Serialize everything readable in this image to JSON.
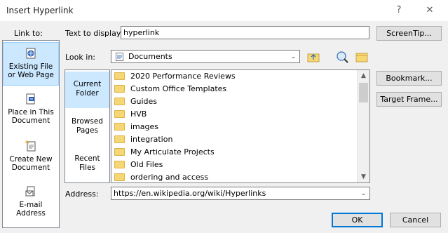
{
  "window": {
    "title": "Insert Hyperlink",
    "help": "?",
    "close": "✕"
  },
  "link_to": {
    "label": "Link to:",
    "items": [
      {
        "line1": "Existing File",
        "line2": "or Web Page",
        "icon": "web-page-icon",
        "selected": true
      },
      {
        "line1": "Place in This",
        "line2": "Document",
        "icon": "document-place-icon",
        "selected": false
      },
      {
        "line1": "Create New",
        "line2": "Document",
        "icon": "new-document-icon",
        "selected": false
      },
      {
        "line1": "E-mail",
        "line2": "Address",
        "icon": "email-icon",
        "selected": false
      }
    ]
  },
  "text_to_display": {
    "label": "Text to display:",
    "value": "hyperlink"
  },
  "screentip_button": "ScreenTip...",
  "look_in": {
    "label": "Look in:",
    "value": "Documents"
  },
  "nav": [
    {
      "line1": "Current",
      "line2": "Folder",
      "selected": true
    },
    {
      "line1": "Browsed",
      "line2": "Pages",
      "selected": false
    },
    {
      "line1": "Recent",
      "line2": "Files",
      "selected": false
    }
  ],
  "files": [
    "2020 Performance Reviews",
    "Custom Office Templates",
    "Guides",
    "HVB",
    "images",
    "integration",
    "My Articulate Projects",
    "Old Files",
    "ordering and access"
  ],
  "bookmark_button": "Bookmark...",
  "target_frame_button": "Target Frame...",
  "address": {
    "label": "Address:",
    "value": "https://en.wikipedia.org/wiki/Hyperlinks"
  },
  "ok_button": "OK",
  "cancel_button": "Cancel",
  "colors": {
    "selection": "#cce8ff",
    "accent": "#0078d7",
    "folder": "#f6d776"
  }
}
